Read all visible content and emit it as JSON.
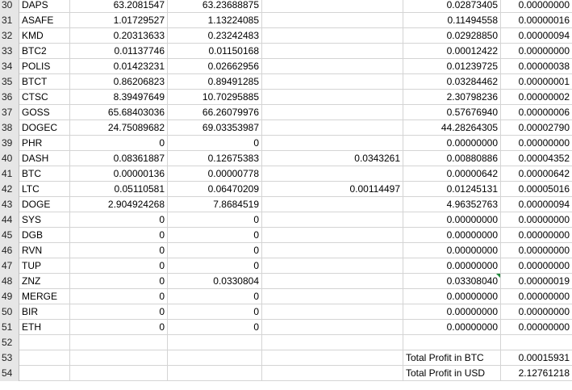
{
  "rows": [
    {
      "num": "30",
      "name": "DAPS",
      "b": "63.2081547",
      "c": "63.23688875",
      "d": "",
      "e": "0.02873405",
      "f": "0.00000000"
    },
    {
      "num": "31",
      "name": "ASAFE",
      "b": "1.01729527",
      "c": "1.13224085",
      "d": "",
      "e": "0.11494558",
      "f": "0.00000016"
    },
    {
      "num": "32",
      "name": "KMD",
      "b": "0.20313633",
      "c": "0.23242483",
      "d": "",
      "e": "0.02928850",
      "f": "0.00000094"
    },
    {
      "num": "33",
      "name": "BTC2",
      "b": "0.01137746",
      "c": "0.01150168",
      "d": "",
      "e": "0.00012422",
      "f": "0.00000000"
    },
    {
      "num": "34",
      "name": "POLIS",
      "b": "0.01423231",
      "c": "0.02662956",
      "d": "",
      "e": "0.01239725",
      "f": "0.00000038"
    },
    {
      "num": "35",
      "name": "BTCT",
      "b": "0.86206823",
      "c": "0.89491285",
      "d": "",
      "e": "0.03284462",
      "f": "0.00000001"
    },
    {
      "num": "36",
      "name": "CTSC",
      "b": "8.39497649",
      "c": "10.70295885",
      "d": "",
      "e": "2.30798236",
      "f": "0.00000002"
    },
    {
      "num": "37",
      "name": "GOSS",
      "b": "65.68403036",
      "c": "66.26079976",
      "d": "",
      "e": "0.57676940",
      "f": "0.00000006"
    },
    {
      "num": "38",
      "name": "DOGEC",
      "b": "24.75089682",
      "c": "69.03353987",
      "d": "",
      "e": "44.28264305",
      "f": "0.00002790"
    },
    {
      "num": "39",
      "name": "PHR",
      "b": "0",
      "c": "0",
      "d": "",
      "e": "0.00000000",
      "f": "0.00000000"
    },
    {
      "num": "40",
      "name": "DASH",
      "b": "0.08361887",
      "c": "0.12675383",
      "d": "0.0343261",
      "e": "0.00880886",
      "f": "0.00004352"
    },
    {
      "num": "41",
      "name": "BTC",
      "b": "0.00000136",
      "c": "0.00000778",
      "d": "",
      "e": "0.00000642",
      "f": "0.00000642"
    },
    {
      "num": "42",
      "name": "LTC",
      "b": "0.05110581",
      "c": "0.06470209",
      "d": "0.00114497",
      "e": "0.01245131",
      "f": "0.00005016"
    },
    {
      "num": "43",
      "name": "DOGE",
      "b": "2.904924268",
      "c": "7.8684519",
      "d": "",
      "e": "4.96352763",
      "f": "0.00000094"
    },
    {
      "num": "44",
      "name": "SYS",
      "b": "0",
      "c": "0",
      "d": "",
      "e": "0.00000000",
      "f": "0.00000000"
    },
    {
      "num": "45",
      "name": "DGB",
      "b": "0",
      "c": "0",
      "d": "",
      "e": "0.00000000",
      "f": "0.00000000"
    },
    {
      "num": "46",
      "name": "RVN",
      "b": "0",
      "c": "0",
      "d": "",
      "e": "0.00000000",
      "f": "0.00000000"
    },
    {
      "num": "47",
      "name": "TUP",
      "b": "0",
      "c": "0",
      "d": "",
      "e": "0.00000000",
      "f": "0.00000000"
    },
    {
      "num": "48",
      "name": "ZNZ",
      "b": "0",
      "c": "0.0330804",
      "d": "",
      "e": "0.03308040",
      "f": "0.00000019",
      "mark": true
    },
    {
      "num": "49",
      "name": "MERGE",
      "b": "0",
      "c": "0",
      "d": "",
      "e": "0.00000000",
      "f": "0.00000000"
    },
    {
      "num": "50",
      "name": "BIR",
      "b": "0",
      "c": "0",
      "d": "",
      "e": "0.00000000",
      "f": "0.00000000"
    },
    {
      "num": "51",
      "name": "ETH",
      "b": "0",
      "c": "0",
      "d": "",
      "e": "0.00000000",
      "f": "0.00000000"
    },
    {
      "num": "52",
      "name": "",
      "b": "",
      "c": "",
      "d": "",
      "e": "",
      "f": ""
    }
  ],
  "totals": [
    {
      "num": "53",
      "label": "Total Profit in BTC",
      "value": "0.00015931"
    },
    {
      "num": "54",
      "label": "Total Profit in USD",
      "value": "2.12761218"
    }
  ],
  "colors": {
    "header_bg": "#e6e6e6",
    "gridline": "#d4d4d4",
    "comment_marker": "#1e8b3a"
  }
}
